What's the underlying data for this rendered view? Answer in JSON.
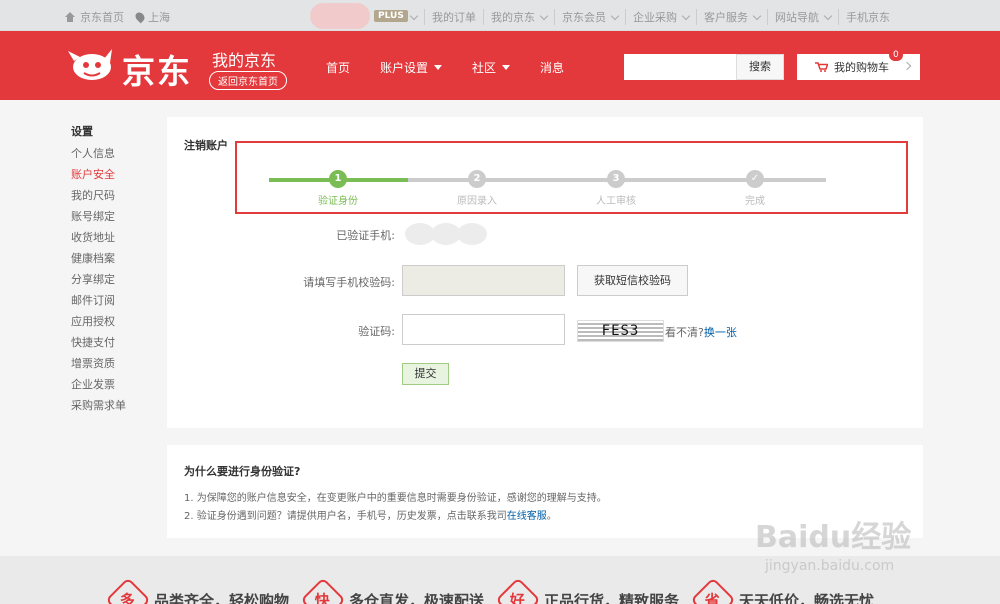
{
  "topbar": {
    "home": "京东首页",
    "location": "上海",
    "plus": "PLUS",
    "links": [
      "我的订单",
      "我的京东",
      "京东会员",
      "企业采购",
      "客户服务",
      "网站导航",
      "手机京东"
    ]
  },
  "header": {
    "logo": "京东",
    "my_jd": "我的京东",
    "back_home": "返回京东首页",
    "nav": [
      "首页",
      "账户设置",
      "社区",
      "消息"
    ],
    "search_button": "搜索",
    "cart_label": "我的购物车",
    "cart_count": "0"
  },
  "sidebar": {
    "title": "设置",
    "items": [
      "个人信息",
      "账户安全",
      "我的尺码",
      "账号绑定",
      "收货地址",
      "健康档案",
      "分享绑定",
      "邮件订阅",
      "应用授权",
      "快捷支付",
      "增票资质",
      "企业发票",
      "采购需求单"
    ]
  },
  "main": {
    "title": "注销账户",
    "steps": [
      {
        "num": "1",
        "label": "验证身份"
      },
      {
        "num": "2",
        "label": "原因录入"
      },
      {
        "num": "3",
        "label": "人工审核"
      },
      {
        "num": "✓",
        "label": "完成"
      }
    ],
    "progress_fraction": 0.25,
    "verified_phone_label": "已验证手机:",
    "code_label": "请填写手机校验码:",
    "sms_button": "获取短信校验码",
    "captcha_label": "验证码:",
    "captcha_text": "FES3",
    "captcha_hint": "看不清?",
    "captcha_refresh": "换一张",
    "submit": "提交"
  },
  "why": {
    "title": "为什么要进行身份验证?",
    "line1": "1. 为保障您的账户信息安全，在变更账户中的重要信息时需要身份验证，感谢您的理解与支持。",
    "line2_prefix": "2. 验证身份遇到问题？请提供用户名，手机号，历史发票，点击联系我司",
    "line2_link": "在线客服",
    "line2_suffix": "。"
  },
  "footer": {
    "promos": [
      {
        "icon": "多",
        "text": "品类齐全，轻松购物"
      },
      {
        "icon": "快",
        "text": "多仓直发，极速配送"
      },
      {
        "icon": "好",
        "text": "正品行货，精致服务"
      },
      {
        "icon": "省",
        "text": "天天低价，畅选无忧"
      }
    ]
  },
  "watermark": {
    "main": "Baidu经验",
    "sub": "jingyan.baidu.com"
  }
}
